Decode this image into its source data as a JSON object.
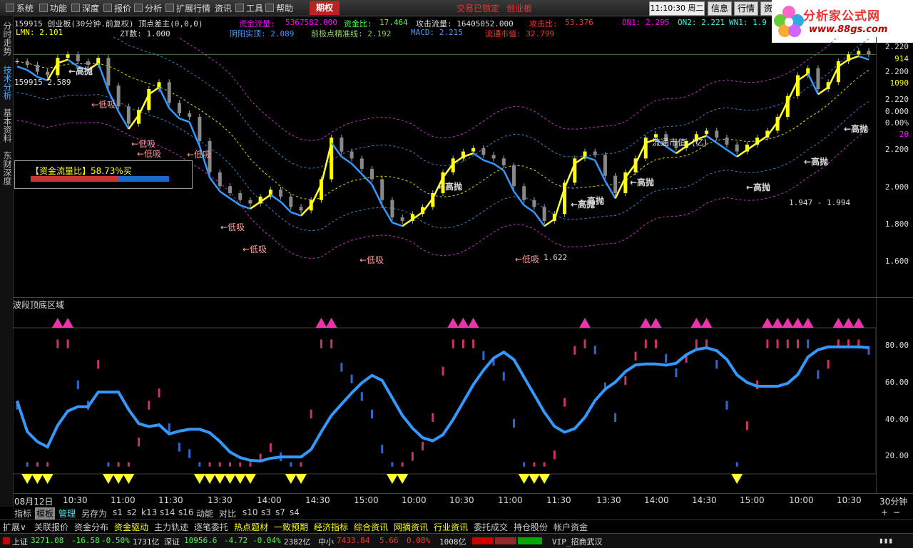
{
  "menu": {
    "items": [
      "系统",
      "功能",
      "深度",
      "报价",
      "分析",
      "扩展行情",
      "资讯",
      "工具",
      "帮助"
    ],
    "futures_tab": "期权",
    "status_center": "交易已锁定",
    "status_center2": "创业板",
    "clock": "11:10:30 周二",
    "buttons": [
      "信息",
      "行情",
      "资"
    ]
  },
  "logo": {
    "title": "分析家公式网",
    "url": "www.88gs.com"
  },
  "left_tabs": [
    "分时走势",
    "技术分析",
    "基本资料",
    "东财深度"
  ],
  "header": {
    "row1_title": "159915 创业板(30分钟.前复权) 顶点差主(0,0,0)",
    "flow_label": "资金流量:",
    "flow_value": "5367582.000",
    "ratio_label": "资金比:",
    "ratio_value": "17.464",
    "attack_flow": "攻击流量: 16405052.000",
    "attack_ratio_label": "攻击比:",
    "attack_ratio_value": "53.376",
    "on1": "ON1: 2.295",
    "on2": "ON2: 2.221",
    "wn1": "WN1: 1.9",
    "lmn": "LMN: 2.101",
    "zt": "ZT数: 1.000",
    "yinyang": "阴阳实顶: 2.089",
    "precise": "前极点精准线: 2.192",
    "macd": "MACD: 2.215",
    "float_cap": "流通市值: 32.799"
  },
  "price_axis": [
    "2.220",
    "914",
    "2.200",
    "1090",
    "2.220",
    "0.000",
    "0.00%",
    "20",
    "2.200",
    "2.000",
    "1.800",
    "1.600"
  ],
  "price_axis_colors": [
    "#ddd",
    "#ff0",
    "#ddd",
    "#ff0",
    "#ddd",
    "#ddd",
    "#ddd",
    "#f0f",
    "#ddd",
    "#ddd",
    "#ddd",
    "#ddd"
  ],
  "chart_labels": {
    "code_price": "159915 2.589",
    "float_cap_label": "流通市值: (亿)",
    "range": "1.947 - 1.994",
    "low_value": "1.622",
    "sell": "←高抛",
    "buy": "←低吸"
  },
  "capital_box": {
    "label": "【资金流量比】58.73%买"
  },
  "lower_panel": {
    "title": "波段顶底区域",
    "axis": [
      "80.00",
      "60.00",
      "40.00",
      "20.00"
    ]
  },
  "time_axis": [
    "08月12日",
    "10:30",
    "11:00",
    "11:30",
    "13:30",
    "14:00",
    "14:30",
    "15:00",
    "10:00",
    "10:30",
    "11:00",
    "11:30",
    "13:30",
    "14:00",
    "14:30",
    "15:00",
    "10:00",
    "10:30"
  ],
  "period": "30分钟",
  "toolbar1": [
    "指标",
    "模板",
    "管理",
    "另存为",
    "s1",
    "s2",
    "k13",
    "s14",
    "s16",
    "动能",
    "对比",
    "s10",
    "s3",
    "s7",
    "s4"
  ],
  "toolbar2": [
    "扩展∨",
    "关联报价",
    "资金分布",
    "资金驱动",
    "主力轨迹",
    "逐笔委托",
    "热点题材",
    "一致预期",
    "经济指标",
    "综合资讯",
    "网摘资讯",
    "行业资讯",
    "委托成交",
    "持仓股份",
    "帐户资金"
  ],
  "status": {
    "sh_label": "上证",
    "sh_value": "3271.08",
    "sh_chg": "-16.58",
    "sh_pct": "-0.50%",
    "sh_amt": "1731亿",
    "sz_label": "深证",
    "sz_value": "10956.6",
    "sz_chg": "-4.72",
    "sz_pct": "-0.04%",
    "sz_amt": "2382亿",
    "zx_label": "中小",
    "zx_value": "7433.84",
    "zx_chg": "5.66",
    "zx_pct": "0.08%",
    "zx_amt": "1008亿",
    "broker": "VIP_招商武汉"
  },
  "colors": {
    "up": "#ff0000",
    "down": "#00ff00",
    "accent": "#ffff00",
    "band": "#ff00ff",
    "blue_line": "#3399ff"
  },
  "chart_data": {
    "type": "line",
    "main": {
      "title": "159915 创业板(30分钟.前复权) 顶点差主(0,0,0)",
      "ylim": [
        1.5,
        2.25
      ],
      "close": [
        2.18,
        2.17,
        2.15,
        2.14,
        2.19,
        2.2,
        2.18,
        2.17,
        2.19,
        2.11,
        2.05,
        2.0,
        2.04,
        2.1,
        2.12,
        2.06,
        2.03,
        2.02,
        1.95,
        1.86,
        1.82,
        1.8,
        1.78,
        1.77,
        1.79,
        1.81,
        1.79,
        1.76,
        1.75,
        1.78,
        1.84,
        1.96,
        1.92,
        1.9,
        1.87,
        1.84,
        1.78,
        1.73,
        1.72,
        1.74,
        1.76,
        1.8,
        1.86,
        1.9,
        1.92,
        1.93,
        1.91,
        1.9,
        1.88,
        1.82,
        1.78,
        1.76,
        1.72,
        1.74,
        1.83,
        1.9,
        1.92,
        1.91,
        1.85,
        1.8,
        1.86,
        1.9,
        1.96,
        1.97,
        1.95,
        1.93,
        1.95,
        1.97,
        1.98,
        1.96,
        1.94,
        1.92,
        1.94,
        1.96,
        1.98,
        2.02,
        2.08,
        2.14,
        2.16,
        2.1,
        2.12,
        2.18,
        2.2,
        2.21,
        2.2
      ]
    },
    "lower": {
      "title": "波段顶底区域",
      "ylim": [
        0,
        100
      ],
      "ticks": [
        80,
        60,
        40,
        20
      ]
    }
  }
}
